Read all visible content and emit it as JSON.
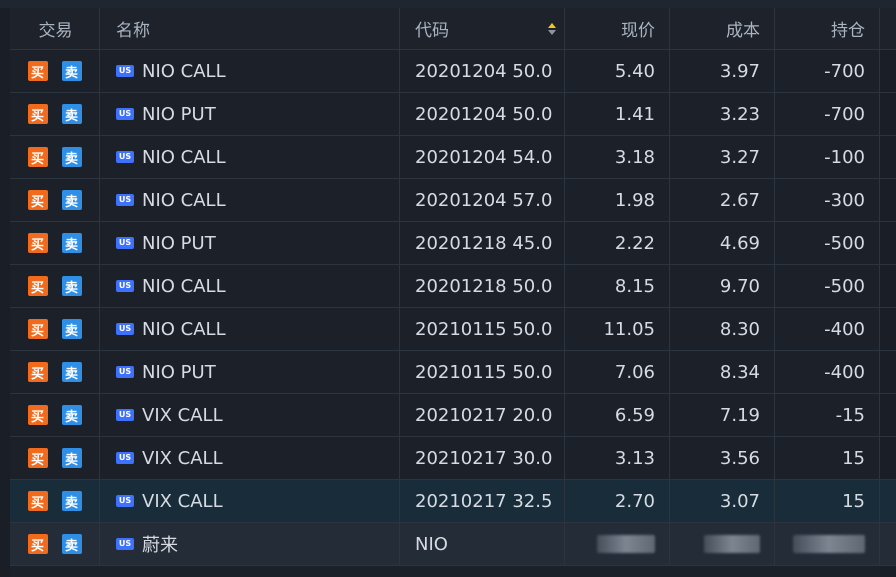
{
  "table": {
    "headers": {
      "trade": "交易",
      "name": "名称",
      "code": "代码",
      "price": "现价",
      "cost": "成本",
      "position": "持仓"
    },
    "buttons": {
      "buy": "买",
      "sell": "卖"
    },
    "market_badge": "US",
    "rows": [
      {
        "name": "NIO CALL",
        "code": "20201204 50.0",
        "price": "5.40",
        "cost": "3.97",
        "position": "-700"
      },
      {
        "name": "NIO PUT",
        "code": "20201204 50.0",
        "price": "1.41",
        "cost": "3.23",
        "position": "-700"
      },
      {
        "name": "NIO CALL",
        "code": "20201204 54.0",
        "price": "3.18",
        "cost": "3.27",
        "position": "-100"
      },
      {
        "name": "NIO CALL",
        "code": "20201204 57.0",
        "price": "1.98",
        "cost": "2.67",
        "position": "-300"
      },
      {
        "name": "NIO PUT",
        "code": "20201218 45.0",
        "price": "2.22",
        "cost": "4.69",
        "position": "-500"
      },
      {
        "name": "NIO CALL",
        "code": "20201218 50.0",
        "price": "8.15",
        "cost": "9.70",
        "position": "-500"
      },
      {
        "name": "NIO CALL",
        "code": "20210115 50.0",
        "price": "11.05",
        "cost": "8.30",
        "position": "-400"
      },
      {
        "name": "NIO PUT",
        "code": "20210115 50.0",
        "price": "7.06",
        "cost": "8.34",
        "position": "-400"
      },
      {
        "name": "VIX CALL",
        "code": "20210217 20.0",
        "price": "6.59",
        "cost": "7.19",
        "position": "-15"
      },
      {
        "name": "VIX CALL",
        "code": "20210217 30.0",
        "price": "3.13",
        "cost": "3.56",
        "position": "15"
      },
      {
        "name": "VIX CALL",
        "code": "20210217 32.5",
        "price": "2.70",
        "cost": "3.07",
        "position": "15"
      },
      {
        "name": "蔚来",
        "code": "NIO",
        "price": "",
        "cost": "",
        "position": ""
      }
    ]
  },
  "colors": {
    "background": "#1c2129",
    "grid": "#2c3440",
    "buy": "#f26b1d",
    "sell": "#2f8fe7",
    "badge": "#3f71ff",
    "sort_active": "#f5c518"
  }
}
